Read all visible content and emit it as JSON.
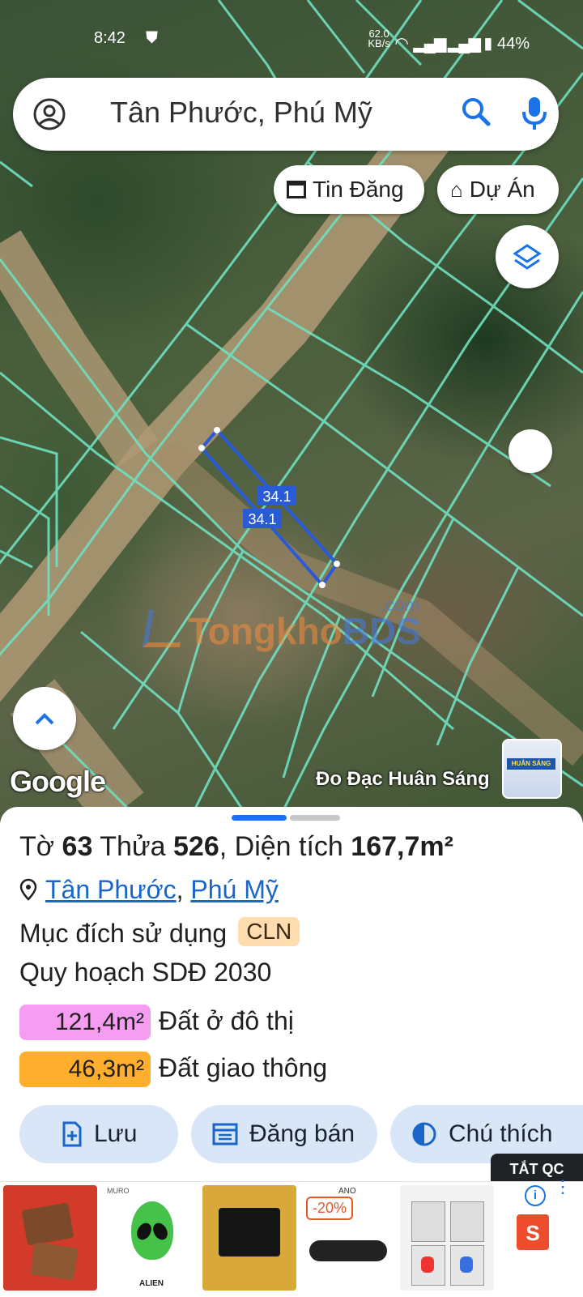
{
  "status": {
    "time": "8:42",
    "net_speed": "62.0",
    "net_unit": "KB/s",
    "battery": "44%"
  },
  "search": {
    "query": "Tân Phước, Phú Mỹ"
  },
  "chips": {
    "listings": "Tin Đăng",
    "projects": "Dự Án"
  },
  "map": {
    "google_label": "Google",
    "measure_1": "34.1",
    "measure_2": "34.1",
    "watermark_a": "Tongkho",
    "watermark_b": "BDS",
    "watermark_com": ".com",
    "credit": "Đo Đạc Huân Sáng",
    "thumb_text": "HUÂN SÁNG"
  },
  "parcel": {
    "to_label": "Tờ",
    "to_value": "63",
    "thua_label": "Thửa",
    "thua_value": "526",
    "area_label": ", Diện tích",
    "area_value": "167,7m²",
    "location_1": "Tân Phước",
    "location_sep": ", ",
    "location_2": "Phú Mỹ",
    "purpose_label": "Mục đích sử dụng",
    "purpose_code": "CLN",
    "plan_label": "Quy hoạch SDĐ 2030",
    "zones": [
      {
        "area": "121,4m²",
        "name": "Đất ở đô thị",
        "color": "#f59df0"
      },
      {
        "area": "46,3m²",
        "name": "Đất giao thông",
        "color": "#ffae2e"
      }
    ]
  },
  "actions": {
    "save": "Lưu",
    "sell": "Đăng bán",
    "legend": "Chú thích"
  },
  "ads": {
    "close_label": "TẮT QC",
    "discount": "-20%",
    "brand": "MURO",
    "alien_label": "ALIEN",
    "ano": "ANO"
  },
  "colors": {
    "accent": "#1a73e8",
    "parcel_line": "#6fe0c0",
    "selected": "#2a5bd7"
  }
}
